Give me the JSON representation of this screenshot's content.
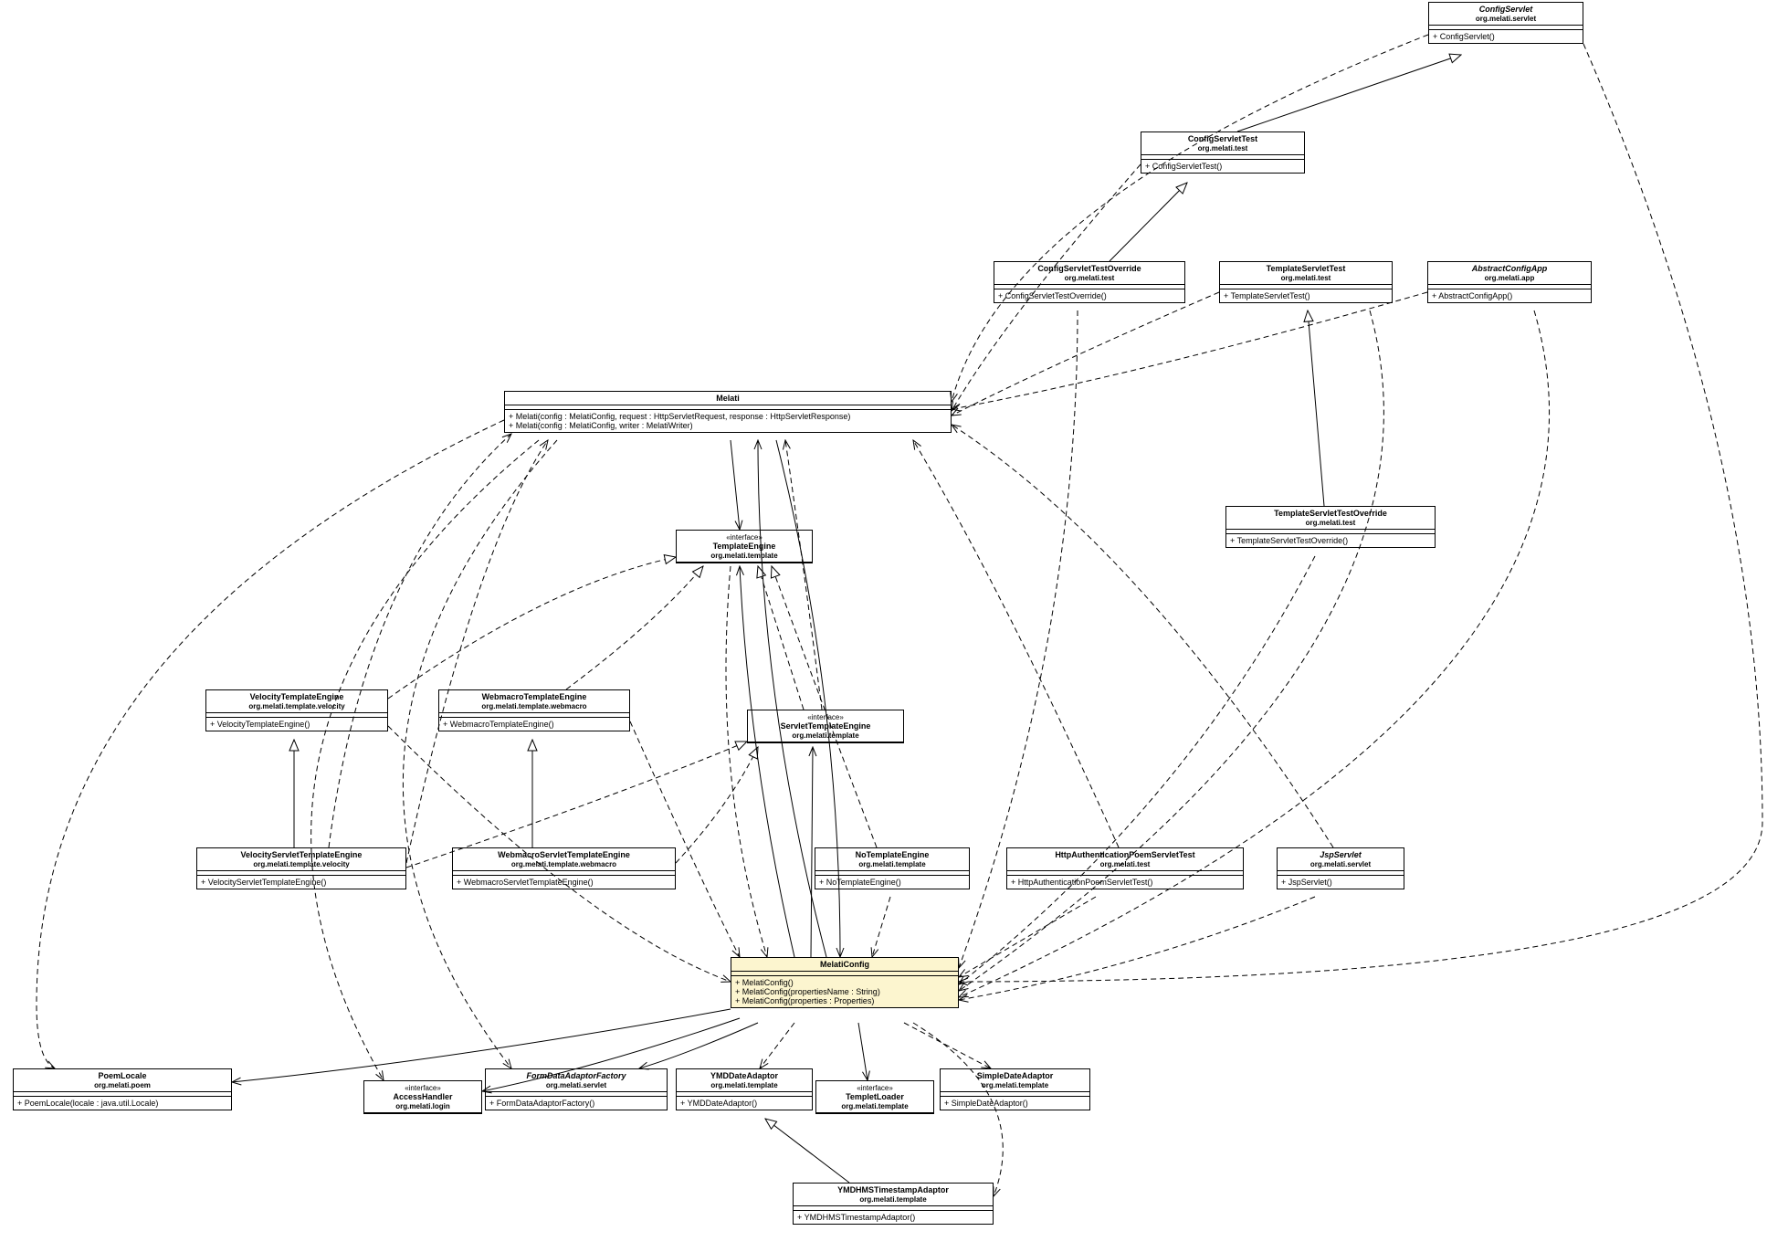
{
  "classes": {
    "ConfigServlet": {
      "name": "ConfigServlet",
      "pkg": "org.melati.servlet",
      "ops": [
        "+ ConfigServlet()"
      ],
      "italic": true
    },
    "ConfigServletTest": {
      "name": "ConfigServletTest",
      "pkg": "org.melati.test",
      "ops": [
        "+ ConfigServletTest()"
      ]
    },
    "ConfigServletTestOverride": {
      "name": "ConfigServletTestOverride",
      "pkg": "org.melati.test",
      "ops": [
        "+ ConfigServletTestOverride()"
      ]
    },
    "TemplateServletTest": {
      "name": "TemplateServletTest",
      "pkg": "org.melati.test",
      "ops": [
        "+ TemplateServletTest()"
      ]
    },
    "AbstractConfigApp": {
      "name": "AbstractConfigApp",
      "pkg": "org.melati.app",
      "ops": [
        "+ AbstractConfigApp()"
      ],
      "italic": true
    },
    "Melati": {
      "name": "Melati",
      "pkg": "",
      "ops": [
        "+ Melati(config : MelatiConfig, request : HttpServletRequest, response : HttpServletResponse)",
        "+ Melati(config : MelatiConfig, writer : MelatiWriter)"
      ]
    },
    "TemplateServletTestOverride": {
      "name": "TemplateServletTestOverride",
      "pkg": "org.melati.test",
      "ops": [
        "+ TemplateServletTestOverride()"
      ]
    },
    "TemplateEngine": {
      "stereo": "«interface»",
      "name": "TemplateEngine",
      "pkg": "org.melati.template",
      "ops": []
    },
    "ServletTemplateEngine": {
      "stereo": "«interface»",
      "name": "ServletTemplateEngine",
      "pkg": "org.melati.template",
      "ops": []
    },
    "VelocityTemplateEngine": {
      "name": "VelocityTemplateEngine",
      "pkg": "org.melati.template.velocity",
      "ops": [
        "+ VelocityTemplateEngine()"
      ]
    },
    "WebmacroTemplateEngine": {
      "name": "WebmacroTemplateEngine",
      "pkg": "org.melati.template.webmacro",
      "ops": [
        "+ WebmacroTemplateEngine()"
      ]
    },
    "VelocityServletTemplateEngine": {
      "name": "VelocityServletTemplateEngine",
      "pkg": "org.melati.template.velocity",
      "ops": [
        "+ VelocityServletTemplateEngine()"
      ]
    },
    "WebmacroServletTemplateEngine": {
      "name": "WebmacroServletTemplateEngine",
      "pkg": "org.melati.template.webmacro",
      "ops": [
        "+ WebmacroServletTemplateEngine()"
      ]
    },
    "NoTemplateEngine": {
      "name": "NoTemplateEngine",
      "pkg": "org.melati.template",
      "ops": [
        "+ NoTemplateEngine()"
      ]
    },
    "HttpAuthenticationPoemServletTest": {
      "name": "HttpAuthenticationPoemServletTest",
      "pkg": "org.melati.test",
      "ops": [
        "+ HttpAuthenticationPoemServletTest()"
      ]
    },
    "JspServlet": {
      "name": "JspServlet",
      "pkg": "org.melati.servlet",
      "ops": [
        "+ JspServlet()"
      ],
      "italic": true
    },
    "MelatiConfig": {
      "name": "MelatiConfig",
      "pkg": "",
      "ops": [
        "+ MelatiConfig()",
        "+ MelatiConfig(propertiesName : String)",
        "+ MelatiConfig(properties : Properties)"
      ]
    },
    "PoemLocale": {
      "name": "PoemLocale",
      "pkg": "org.melati.poem",
      "ops": [
        "+ PoemLocale(locale : java.util.Locale)"
      ]
    },
    "AccessHandler": {
      "stereo": "«interface»",
      "name": "AccessHandler",
      "pkg": "org.melati.login",
      "ops": []
    },
    "FormDataAdaptorFactory": {
      "name": "FormDataAdaptorFactory",
      "pkg": "org.melati.servlet",
      "ops": [
        "+ FormDataAdaptorFactory()"
      ],
      "italic": true
    },
    "YMDDateAdaptor": {
      "name": "YMDDateAdaptor",
      "pkg": "org.melati.template",
      "ops": [
        "+ YMDDateAdaptor()"
      ]
    },
    "TempletLoader": {
      "stereo": "«interface»",
      "name": "TempletLoader",
      "pkg": "org.melati.template",
      "ops": []
    },
    "SimpleDateAdaptor": {
      "name": "SimpleDateAdaptor",
      "pkg": "org.melati.template",
      "ops": [
        "+ SimpleDateAdaptor()"
      ]
    },
    "YMDHMSTimestampAdaptor": {
      "name": "YMDHMSTimestampAdaptor",
      "pkg": "org.melati.template",
      "ops": [
        "+ YMDHMSTimestampAdaptor()"
      ]
    }
  }
}
